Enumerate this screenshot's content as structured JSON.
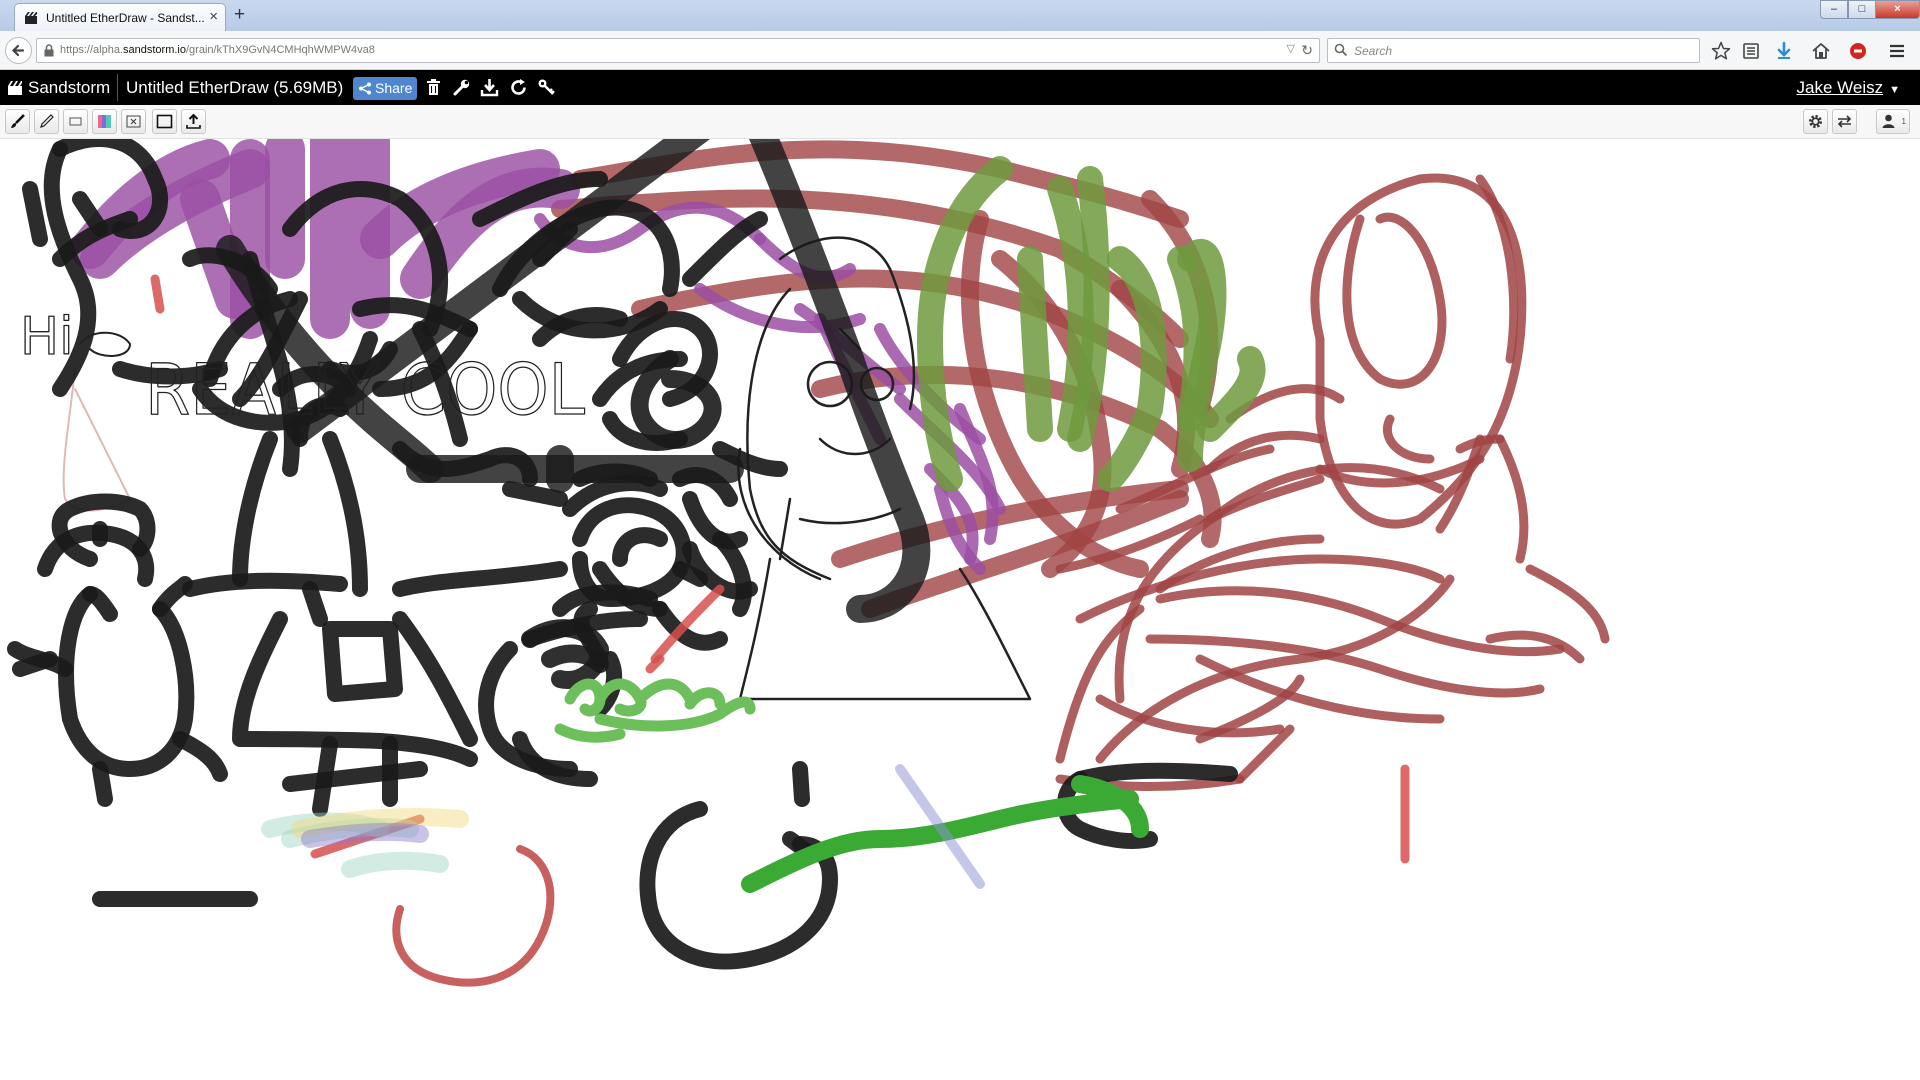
{
  "browser": {
    "tab_title": "Untitled EtherDraw - Sandst...",
    "tab_close": "×",
    "new_tab": "+",
    "url_prefix": "https://alpha.",
    "url_domain": "sandstorm.io",
    "url_path": "/grain/kThX9GvN4CMHqhWMPW4va8",
    "search_placeholder": "Search",
    "window_controls": {
      "minimize": "–",
      "maximize": "□",
      "close": "×"
    }
  },
  "sandstorm": {
    "brand": "Sandstorm",
    "document_title": "Untitled EtherDraw  (5.69MB)",
    "share_label": "Share",
    "user_name": "Jake Weisz",
    "user_caret": "▼"
  },
  "toolbar": {
    "left_tools": [
      "brush-tool",
      "pencil-tool",
      "rectangle-tool",
      "color-picker",
      "clear-canvas-tool",
      "frame-tool",
      "upload-tool"
    ],
    "right_tools": [
      "settings",
      "toggle-view",
      "users"
    ],
    "user_count": "1"
  },
  "canvas": {
    "handwritten_text": [
      {
        "id": "hi",
        "text": "Hi"
      },
      {
        "id": "really-cool",
        "text": "REALLY COOL"
      }
    ]
  },
  "colors": {
    "sandstorm_bar": "#000000",
    "share_button": "#4f86ce",
    "stroke_black": "#1a1a1a",
    "stroke_purple": "#9b4fa3",
    "stroke_maroon": "#a04444",
    "stroke_olive": "#6f9a3e",
    "stroke_green": "#3aaa35",
    "stroke_red": "#d6504f"
  }
}
